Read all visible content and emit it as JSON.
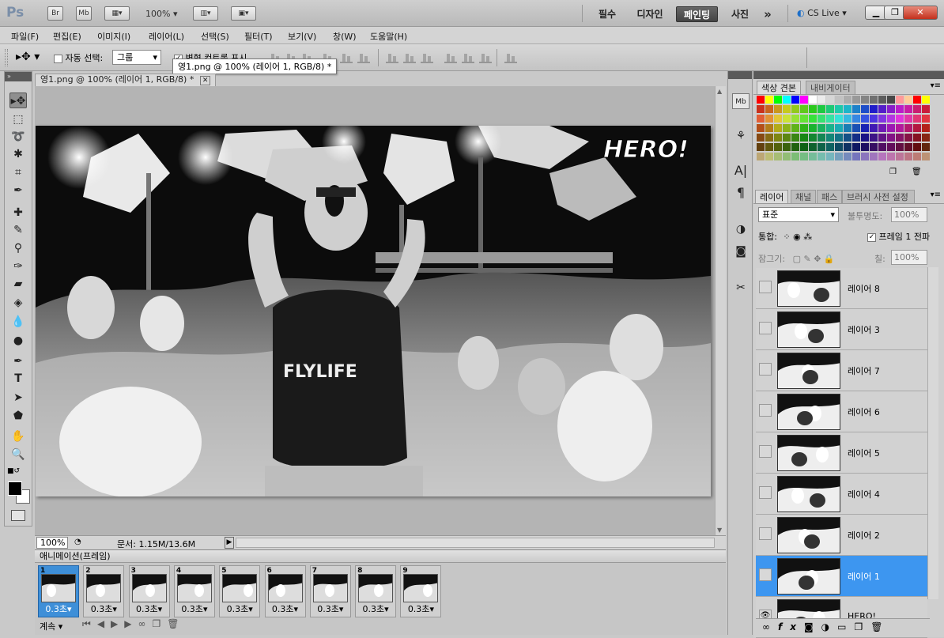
{
  "titlebar": {
    "app_logo": "Ps",
    "bridge": "Br",
    "mini_bridge": "Mb",
    "zoom": "100%",
    "workspaces": [
      "필수",
      "디자인",
      "페인팅",
      "사진"
    ],
    "active_workspace": "페인팅",
    "more": "»",
    "cs_live": "CS Live"
  },
  "menu": [
    "파일(F)",
    "편집(E)",
    "이미지(I)",
    "레이어(L)",
    "선택(S)",
    "필터(T)",
    "보기(V)",
    "창(W)",
    "도움말(H)"
  ],
  "options": {
    "auto_select_label": "자동 선택:",
    "auto_select_value": "그룹",
    "transform_label": "변형 컨트롤 표시"
  },
  "tooltip": "영1.png @ 100% (레이어 1, RGB/8) *",
  "document": {
    "tab_title": "영1.png @ 100% (레이어 1, RGB/8) *",
    "canvas_text": "HERO!",
    "shirt_text": "FLYLIFE"
  },
  "status": {
    "zoom": "100%",
    "doc_info": "문서: 1.15M/13.6M"
  },
  "animation": {
    "title": "애니메이션(프레임)",
    "frames": [
      {
        "num": "1",
        "delay": "0.3초"
      },
      {
        "num": "2",
        "delay": "0.3초"
      },
      {
        "num": "3",
        "delay": "0.3초"
      },
      {
        "num": "4",
        "delay": "0.3초"
      },
      {
        "num": "5",
        "delay": "0.3초"
      },
      {
        "num": "6",
        "delay": "0.3초"
      },
      {
        "num": "7",
        "delay": "0.3초"
      },
      {
        "num": "8",
        "delay": "0.3초"
      },
      {
        "num": "9",
        "delay": "0.3초"
      }
    ],
    "selected_frame": 1,
    "loop": "계속"
  },
  "swatches_panel": {
    "tabs": [
      "색상 견본",
      "내비게이터"
    ]
  },
  "layers_panel": {
    "tabs": [
      "레이어",
      "채널",
      "패스",
      "브러시 사전 설정"
    ],
    "blend_mode": "표준",
    "opacity_label": "불투명도:",
    "opacity_value": "100%",
    "unify_label": "통합:",
    "propagate_label": "프레임 1 전파",
    "lock_label": "잠그기:",
    "fill_label": "칠:",
    "fill_value": "100%",
    "layers": [
      "레이어 8",
      "레이어 3",
      "레이어 7",
      "레이어 6",
      "레이어 5",
      "레이어 4",
      "레이어 2",
      "레이어 1",
      "HERO!"
    ],
    "selected_layer": "레이어 1"
  },
  "colors": {
    "accent": "#3d96f0",
    "panel": "#cfcfcf"
  }
}
